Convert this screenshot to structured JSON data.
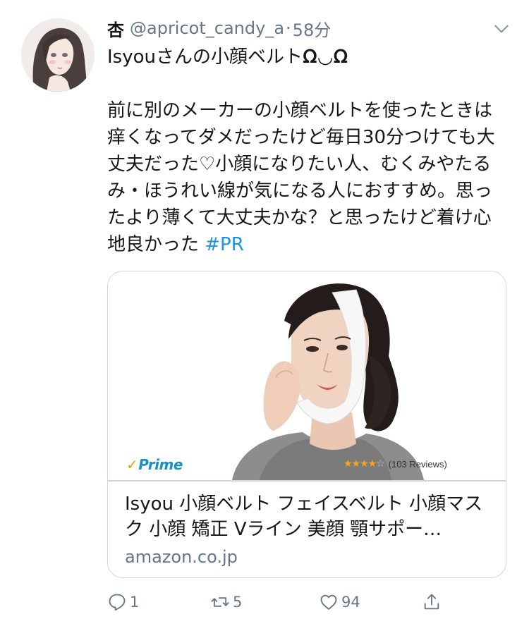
{
  "tweet": {
    "author_name": "杏",
    "handle": "@apricot_candy_a",
    "separator": "·",
    "time": "58分",
    "text_part1": "Isyouさんの小顔ベルト𝛀◡𝛀\n\n前に別のメーカーの小顔ベルトを使ったときは痒くなってダメだったけど毎日30分つけても大丈夫だった♡小顔になりたい人、むくみやたるみ・ほうれい線が気になる人におすすめ。思ったより薄くて大丈夫かな？と思ったけど着け心地良かった ",
    "hashtag": "#PR"
  },
  "card": {
    "badge_check": "✓",
    "badge_label": "Prime",
    "stars_filled": "★★★★",
    "stars_empty": "☆",
    "rating_value": 4,
    "reviews": "(103 Reviews)",
    "title": "Isyou 小顔ベルト フェイスベルト 小顔マスク 小顔 矯正 Vライン 美顔 顎サポー…",
    "domain": "amazon.co.jp"
  },
  "actions": {
    "reply_count": "1",
    "retweet_count": "5",
    "like_count": "94"
  },
  "icons": {
    "reply": "reply-icon",
    "retweet": "retweet-icon",
    "like": "heart-icon",
    "share": "share-icon",
    "menu": "chevron-down-icon"
  },
  "colors": {
    "text": "#14171a",
    "secondary": "#657786",
    "link": "#1b95e0",
    "border": "#ccd6dd"
  }
}
